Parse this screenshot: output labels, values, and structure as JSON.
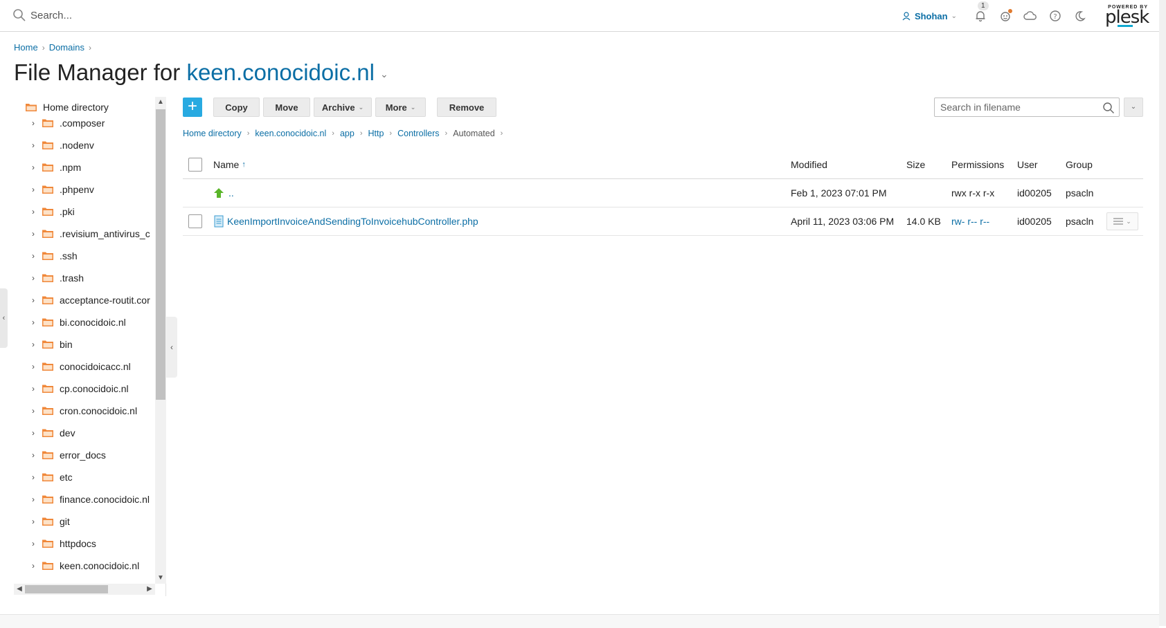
{
  "topbar": {
    "search_placeholder": "Search...",
    "user_name": "Shohan",
    "notifications_count": "1",
    "logo_small": "POWERED BY",
    "logo_big": "plesk"
  },
  "breadcrumbs": [
    "Home",
    "Domains"
  ],
  "title": {
    "prefix": "File Manager for",
    "domain": "keen.conocidoic.nl"
  },
  "tree": {
    "root": "Home directory",
    "items": [
      ".composer",
      ".nodenv",
      ".npm",
      ".phpenv",
      ".pki",
      ".revisium_antivirus_c",
      ".ssh",
      ".trash",
      "acceptance-routit.cor",
      "bi.conocidoic.nl",
      "bin",
      "conocidoicacc.nl",
      "cp.conocidoic.nl",
      "cron.conocidoic.nl",
      "dev",
      "error_docs",
      "etc",
      "finance.conocidoic.nl",
      "git",
      "httpdocs",
      "keen.conocidoic.nl"
    ]
  },
  "toolbar": {
    "add_label": "+",
    "copy": "Copy",
    "move": "Move",
    "archive": "Archive",
    "more": "More",
    "remove": "Remove",
    "search_placeholder": "Search in filename"
  },
  "path": [
    "Home directory",
    "keen.conocidoic.nl",
    "app",
    "Http",
    "Controllers"
  ],
  "path_current": "Automated",
  "table": {
    "headers": {
      "name": "Name",
      "modified": "Modified",
      "size": "Size",
      "permissions": "Permissions",
      "user": "User",
      "group": "Group"
    },
    "rows": [
      {
        "name": "..",
        "modified": "Feb 1, 2023 07:01 PM",
        "size": "",
        "permissions": "rwx r-x r-x",
        "user": "id00205",
        "group": "psacln"
      },
      {
        "name": "KeenImportInvoiceAndSendingToInvoicehubController.php",
        "modified": "April 11, 2023 03:06 PM",
        "size": "14.0 KB",
        "permissions": "rw- r-- r--",
        "user": "id00205",
        "group": "psacln"
      }
    ]
  },
  "colors": {
    "accent": "#0b6ea5",
    "primary_button": "#28aae1",
    "folder": "#f0883a",
    "up_arrow": "#5ab52a"
  }
}
